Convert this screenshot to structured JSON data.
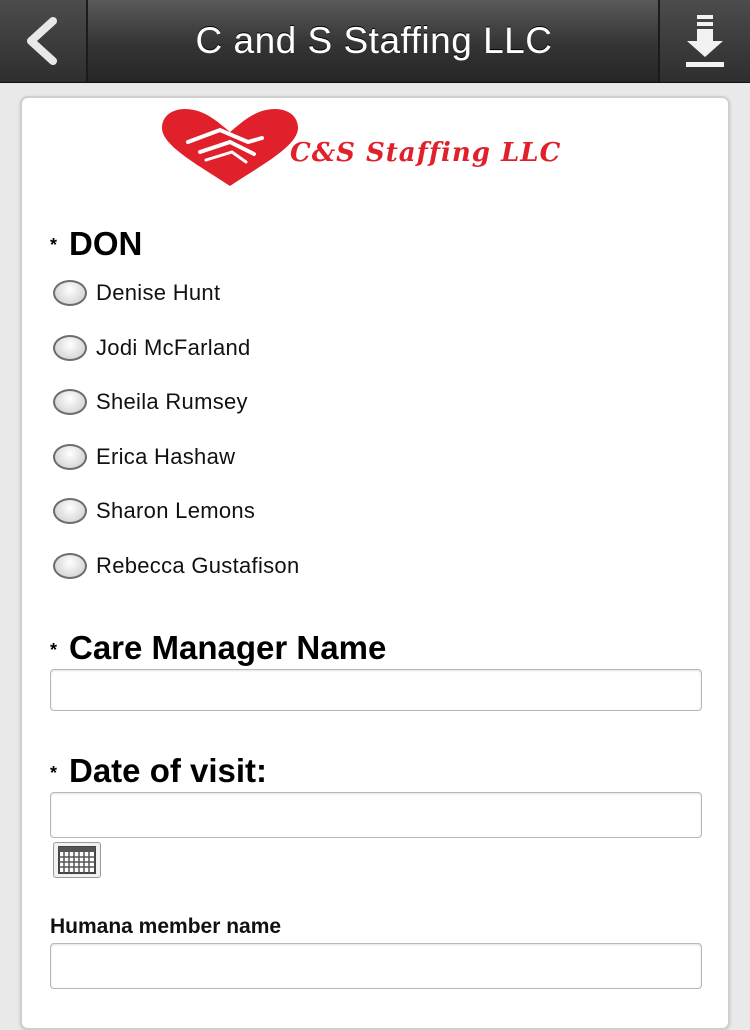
{
  "header": {
    "title": "C and S Staffing LLC",
    "back_icon": "chevron-left-icon",
    "download_icon": "download-icon"
  },
  "logo": {
    "text": "C&S Staffing LLC",
    "color": "#e0202a"
  },
  "form": {
    "required_mark": "*",
    "don": {
      "label": "DON",
      "options": [
        "Denise Hunt",
        "Jodi McFarland",
        "Sheila Rumsey",
        "Erica Hashaw",
        "Sharon Lemons",
        "Rebecca Gustafison"
      ]
    },
    "care_manager": {
      "label": "Care Manager Name",
      "value": ""
    },
    "date_of_visit": {
      "label": "Date of visit:",
      "value": "",
      "calendar_icon": "calendar-icon"
    },
    "humana_member": {
      "label": "Humana member name",
      "value": ""
    }
  }
}
